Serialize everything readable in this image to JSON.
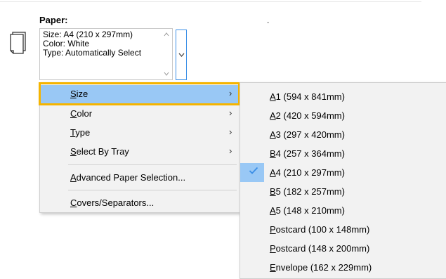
{
  "paper": {
    "title": "Paper:",
    "dot": ".",
    "info": "Size: A4 (210 x 297mm)\nColor: White\nType: Automatically Select"
  },
  "menu": {
    "items": [
      {
        "pre": "",
        "u": "S",
        "post": "ize",
        "has_submenu": true
      },
      {
        "pre": "",
        "u": "C",
        "post": "olor",
        "has_submenu": true
      },
      {
        "pre": "",
        "u": "T",
        "post": "ype",
        "has_submenu": true
      },
      {
        "pre": "",
        "u": "S",
        "post": "elect By Tray",
        "has_submenu": true
      },
      {
        "pre": "",
        "u": "A",
        "post": "dvanced Paper Selection...",
        "has_submenu": false
      },
      {
        "pre": "",
        "u": "C",
        "post": "overs/Separators...",
        "has_submenu": false
      }
    ]
  },
  "submenu": {
    "items": [
      {
        "u": "A",
        "post": "1 (594 x 841mm)",
        "checked": false
      },
      {
        "u": "A",
        "post": "2 (420 x 594mm)",
        "checked": false
      },
      {
        "u": "A",
        "post": "3 (297 x 420mm)",
        "checked": false
      },
      {
        "u": "B",
        "post": "4 (257 x 364mm)",
        "checked": false
      },
      {
        "u": "A",
        "post": "4 (210 x 297mm)",
        "checked": true
      },
      {
        "u": "B",
        "post": "5 (182 x 257mm)",
        "checked": false
      },
      {
        "u": "A",
        "post": "5 (148 x 210mm)",
        "checked": false
      },
      {
        "u": "P",
        "post": "ostcard (100 x 148mm)",
        "checked": false
      },
      {
        "u": "P",
        "post": "ostcard (148 x 200mm)",
        "checked": false
      },
      {
        "u": "E",
        "post": "nvelope (162 x 229mm)",
        "checked": false
      }
    ]
  },
  "colors": {
    "highlight": "#99c8f5",
    "frame": "#f5b400",
    "check": "#3a8ee6"
  }
}
